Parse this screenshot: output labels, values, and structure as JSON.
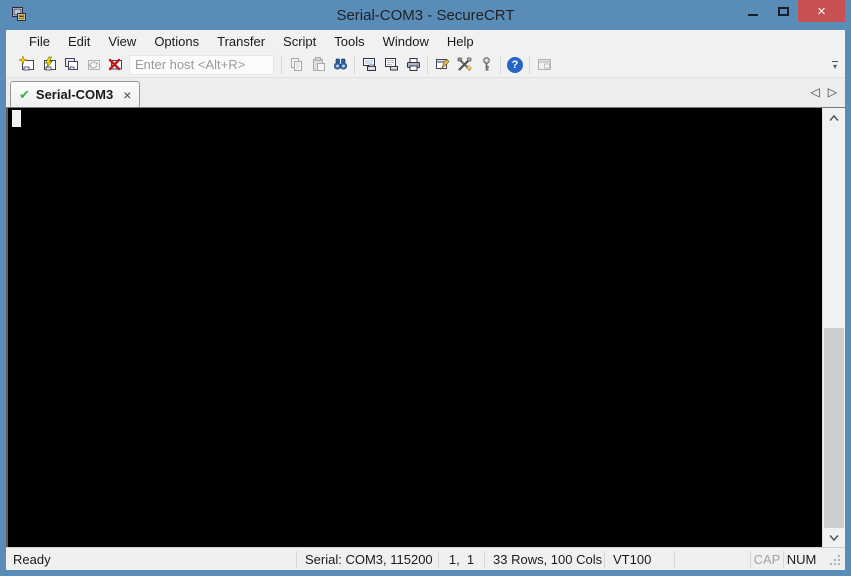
{
  "window": {
    "title": "Serial-COM3 - SecureCRT",
    "controls": {
      "close_glyph": "×"
    }
  },
  "menu": {
    "items": [
      "File",
      "Edit",
      "View",
      "Options",
      "Transfer",
      "Script",
      "Tools",
      "Window",
      "Help"
    ]
  },
  "toolbar": {
    "host_placeholder": "Enter host <Alt+R>",
    "host_value": "",
    "help_glyph": "?",
    "overflow_glyph": "▾",
    "icons": [
      "quick-connect-icon",
      "connect-icon",
      "connect-in-tab-icon",
      "reconnect-icon",
      "disconnect-icon",
      "copy-icon",
      "paste-icon",
      "find-icon",
      "print-screen-icon",
      "auto-print-icon",
      "print-icon",
      "session-options-icon",
      "global-options-icon",
      "key-agent-icon",
      "help-icon",
      "session-manager-icon"
    ]
  },
  "tabs": {
    "active": {
      "label": "Serial-COM3",
      "status_icon": "connected-check-icon",
      "check_glyph": "✔",
      "close_glyph": "×"
    },
    "scroll_left_glyph": "◁",
    "scroll_right_glyph": "▷"
  },
  "terminal": {
    "content": "",
    "cursor": "block at row 1, col 1",
    "rows": 33,
    "cols": 100
  },
  "status_bar": {
    "ready": "Ready",
    "connection": "Serial: COM3, 115200",
    "cursor_pos": "1,  1",
    "size": "33 Rows, 100 Cols",
    "emulation": "VT100",
    "caps_indicator": "CAP",
    "num_indicator": "NUM"
  },
  "colors": {
    "titlebar": "#5a8cb8",
    "close_button": "#c75050",
    "chrome": "#f0f0f0",
    "terminal_bg": "#000000",
    "cursor": "#f2f2f2",
    "tab_check_green": "#3fae49",
    "help_blue": "#2864c8"
  }
}
